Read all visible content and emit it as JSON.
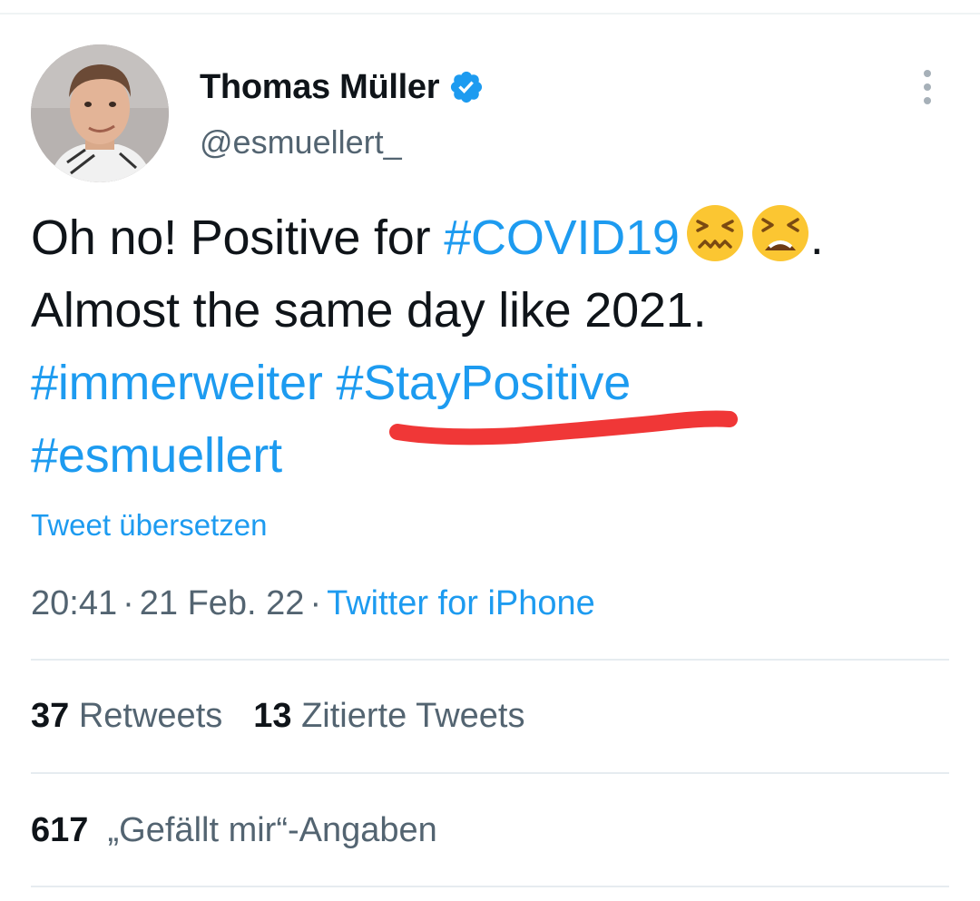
{
  "user": {
    "display_name": "Thomas Müller",
    "handle": "@esmuellert_"
  },
  "tweet": {
    "line1_text": "Oh no! Positive for ",
    "line1_hashtag": "#COVID19",
    "line1_end": ".",
    "line2_text": "Almost the same day like 2021.",
    "hashtag_immerweiter": "#immerweiter",
    "hashtag_staypositive": "#StayPositive",
    "hashtag_esmuellert": "#esmuellert",
    "emojis": [
      "confounded-face-emoji",
      "tired-face-emoji"
    ]
  },
  "translate_label": "Tweet übersetzen",
  "meta": {
    "time": "20:41",
    "separator": "·",
    "date": "21 Feb. 22",
    "source": "Twitter for iPhone"
  },
  "stats": {
    "retweets_count": "37",
    "retweets_label": "Retweets",
    "quotes_count": "13",
    "quotes_label": "Zitierte Tweets",
    "likes_count": "617",
    "likes_label": "„Gefällt mir“-Angaben"
  },
  "colors": {
    "link": "#1d9bf0",
    "text": "#0f1419",
    "secondary": "#536471",
    "annotation_underline": "#f03737"
  }
}
